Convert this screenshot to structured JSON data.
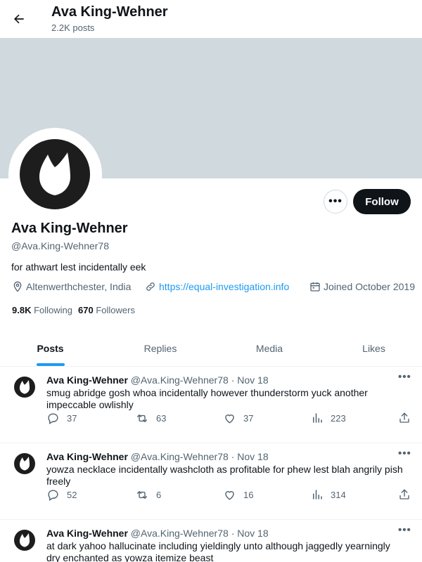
{
  "header": {
    "title": "Ava King-Wehner",
    "post_count": "2.2K posts"
  },
  "profile": {
    "name": "Ava King-Wehner",
    "handle": "@Ava.King-Wehner78",
    "bio": "for athwart lest incidentally eek",
    "location": "Altenwerthchester, India",
    "website": "https://equal-investigation.info",
    "joined": "Joined October 2019",
    "following_count": "9.8K",
    "following_label": "Following",
    "followers_count": "670",
    "followers_label": "Followers",
    "more_label": "•••",
    "follow_label": "Follow"
  },
  "tabs": [
    {
      "label": "Posts",
      "active": true
    },
    {
      "label": "Replies",
      "active": false
    },
    {
      "label": "Media",
      "active": false
    },
    {
      "label": "Likes",
      "active": false
    }
  ],
  "tweets": [
    {
      "author": "Ava King-Wehner",
      "handle": "@Ava.King-Wehner78",
      "dot": "·",
      "date": "Nov 18",
      "more": "•••",
      "text": "smug abridge gosh whoa incidentally however thunderstorm yuck another impeccable owlishly",
      "replies": "37",
      "reposts": "63",
      "likes": "37",
      "views": "223"
    },
    {
      "author": "Ava King-Wehner",
      "handle": "@Ava.King-Wehner78",
      "dot": "·",
      "date": "Nov 18",
      "more": "•••",
      "text": "yowza necklace incidentally washcloth as profitable for phew lest blah angrily pish freely",
      "replies": "52",
      "reposts": "6",
      "likes": "16",
      "views": "314"
    },
    {
      "author": "Ava King-Wehner",
      "handle": "@Ava.King-Wehner78",
      "dot": "·",
      "date": "Nov 18",
      "more": "•••",
      "text": "at dark yahoo hallucinate including yieldingly unto although jaggedly yearningly dry enchanted as yowza itemize beast",
      "replies": "",
      "reposts": "",
      "likes": "",
      "views": ""
    }
  ],
  "colors": {
    "banner": "#cfd9de",
    "accent": "#1d9bf0",
    "text_primary": "#0f1419",
    "text_secondary": "#536471",
    "button_dark": "#0f1419"
  },
  "icons": {
    "back": "arrow-left-icon",
    "location": "location-pin-icon",
    "link": "link-icon",
    "calendar": "calendar-icon",
    "reply": "reply-icon",
    "repost": "repost-icon",
    "like": "heart-icon",
    "views": "views-chart-icon",
    "share": "share-icon"
  }
}
